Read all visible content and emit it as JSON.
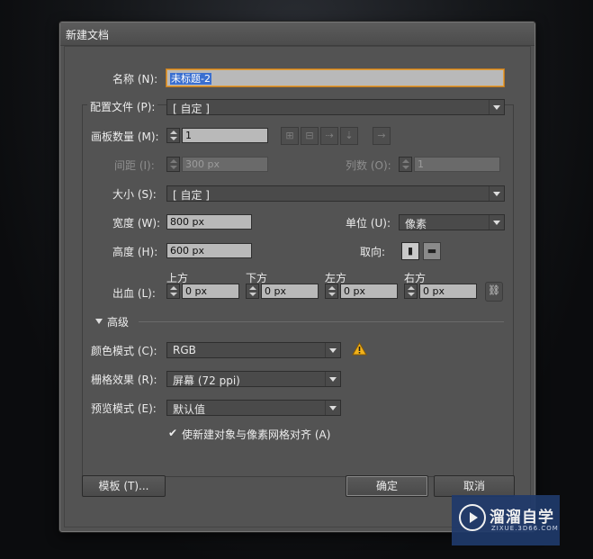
{
  "dialog": {
    "title": "新建文档",
    "name_label": "名称 (N):",
    "name_value": "未标题-2",
    "profile_label": "配置文件 (P):",
    "profile_value": "[ 自定 ]",
    "artboards_label": "画板数量 (M):",
    "artboards_value": "1",
    "spacing_label": "间距 (I):",
    "spacing_value": "300 px",
    "columns_label": "列数 (O):",
    "columns_value": "1",
    "size_label": "大小 (S):",
    "size_value": "[ 自定 ]",
    "width_label": "宽度 (W):",
    "width_value": "800 px",
    "units_label": "单位 (U):",
    "units_value": "像素",
    "height_label": "高度 (H):",
    "height_value": "600 px",
    "orientation_label": "取向:",
    "bleed_label": "出血 (L):",
    "bleed": {
      "top_label": "上方",
      "top_value": "0 px",
      "bottom_label": "下方",
      "bottom_value": "0 px",
      "left_label": "左方",
      "left_value": "0 px",
      "right_label": "右方",
      "right_value": "0 px"
    },
    "advanced_label": "高级",
    "color_mode_label": "颜色模式 (C):",
    "color_mode_value": "RGB",
    "raster_label": "栅格效果 (R):",
    "raster_value": "屏幕 (72 ppi)",
    "preview_label": "预览模式 (E):",
    "preview_value": "默认值",
    "align_checkbox_label": "使新建对象与像素网格对齐 (A)",
    "align_checked": true,
    "templates_button": "模板 (T)...",
    "ok_button": "确定",
    "cancel_button": "取消"
  },
  "watermark": {
    "title": "溜溜自学",
    "subtitle": "ZIXUE.3D66.COM"
  },
  "colors": {
    "dialog_bg": "#535353",
    "field_bg": "#b9b9b9",
    "focus_border": "#e0a040",
    "selection": "#3a6fd0",
    "warning": "#f2b21a"
  }
}
